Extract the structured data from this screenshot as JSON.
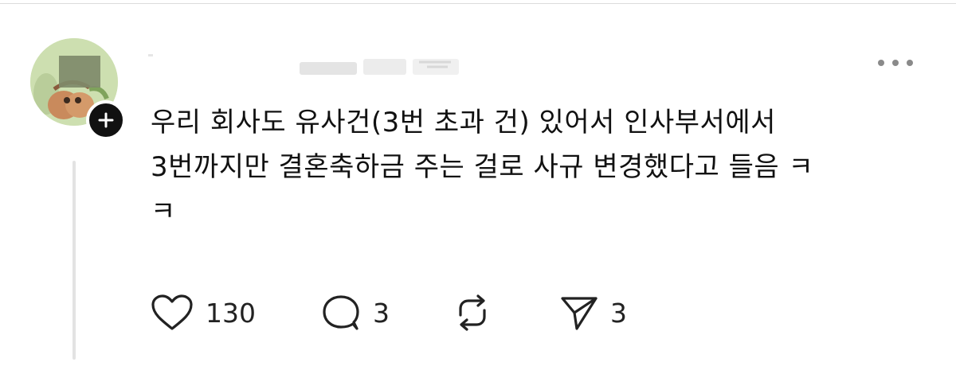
{
  "post": {
    "author_name": "",
    "body_lines": [
      "우리 회사도 유사건(3번 초과 건) 있어서 인사부서에서",
      "3번까지만 결혼축하금 주는 걸로 사규 변경했다고 들음 ㅋ",
      "ㅋ"
    ]
  },
  "actions": {
    "like_count": "130",
    "reply_count": "3",
    "share_count": "3"
  },
  "icons": {
    "follow": "plus-icon",
    "more": "more-horizontal-icon",
    "like": "heart-icon",
    "reply": "comment-bubble-icon",
    "repost": "repost-icon",
    "share": "send-icon"
  },
  "colors": {
    "text": "#111111",
    "muted": "#999999",
    "icon": "#222222",
    "thread_line": "#e3e3e3",
    "badge": "#111111"
  }
}
